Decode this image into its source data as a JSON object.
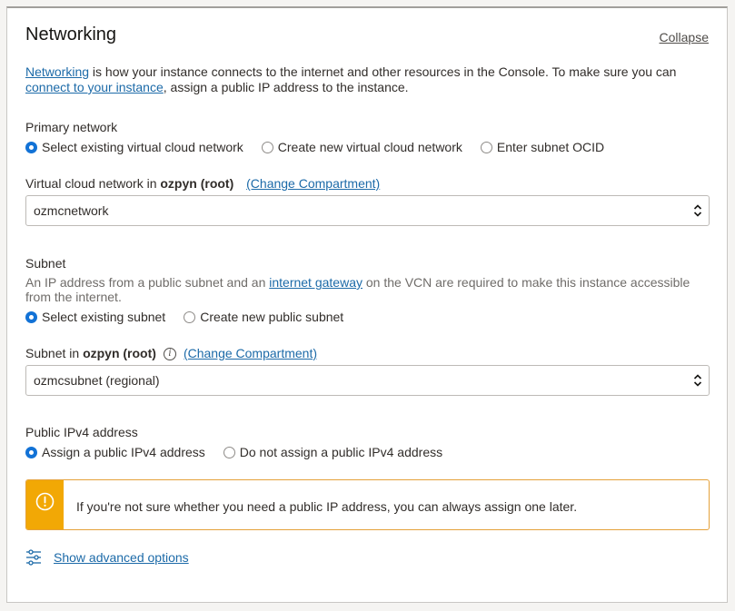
{
  "section": {
    "title": "Networking",
    "collapse_label": "Collapse"
  },
  "intro": {
    "link1": "Networking",
    "text1": " is how your instance connects to the internet and other resources in the Console. To make sure you can",
    "link2": "connect to your instance",
    "text2": ", assign a public IP address to the instance."
  },
  "primary_network": {
    "label": "Primary network",
    "options": [
      "Select existing virtual cloud network",
      "Create new virtual cloud network",
      "Enter subnet OCID"
    ],
    "selected_index": 0
  },
  "vcn": {
    "label_prefix": "Virtual cloud network in ",
    "compartment": "ozpyn (root)",
    "change_compartment": "(Change Compartment)",
    "value": "ozmcnetwork"
  },
  "subnet": {
    "label": "Subnet",
    "help_prefix": "An IP address from a public subnet and an ",
    "help_link": "internet gateway",
    "help_suffix": " on the VCN are required to make this instance accessible",
    "help_line2": "from the internet.",
    "options": [
      "Select existing subnet",
      "Create new public subnet"
    ],
    "selected_index": 0
  },
  "subnet_select": {
    "label_prefix": "Subnet in ",
    "compartment": "ozpyn (root)",
    "change_compartment": "(Change Compartment)",
    "value": "ozmcsubnet (regional)"
  },
  "public_ip": {
    "label": "Public IPv4 address",
    "options": [
      "Assign a public IPv4 address",
      "Do not assign a public IPv4 address"
    ],
    "selected_index": 0
  },
  "warning": {
    "icon": "warning-circle-icon",
    "message": "If you're not sure whether you need a public IP address, you can always assign one later."
  },
  "advanced": {
    "icon": "sliders-icon",
    "label": "Show advanced options"
  },
  "colors": {
    "link": "#1c6aa8",
    "radio_selected": "#1272d6",
    "warning_bar": "#f2a805",
    "warning_border": "#e5a13a"
  }
}
